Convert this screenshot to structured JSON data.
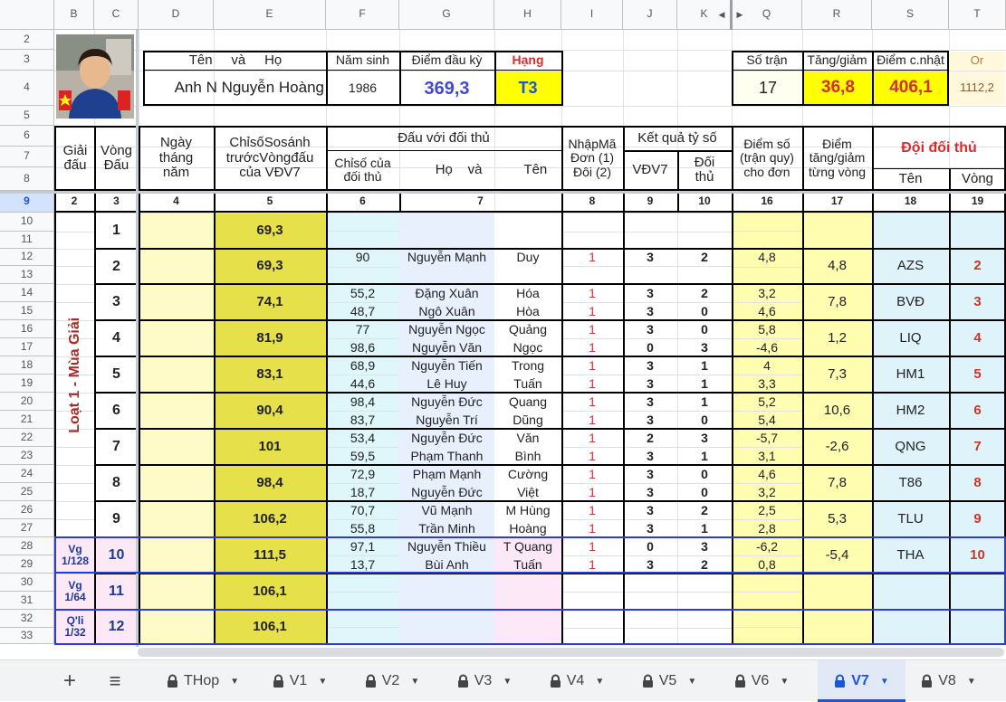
{
  "col_headers": [
    "B",
    "C",
    "D",
    "E",
    "F",
    "G",
    "H",
    "I",
    "J",
    "K",
    "Q",
    "R",
    "S",
    "T"
  ],
  "row_numbers": [
    "2",
    "3",
    "4",
    "5",
    "6",
    "7",
    "8",
    "9",
    "10",
    "11",
    "12",
    "13",
    "14",
    "15",
    "16",
    "17",
    "18",
    "19",
    "20",
    "21",
    "22",
    "23",
    "24",
    "25",
    "26",
    "27",
    "28",
    "29",
    "30",
    "31",
    "32",
    "33"
  ],
  "header": {
    "ten": "Tên",
    "va": "và",
    "ho": "Họ",
    "nam_sinh": "Năm sinh",
    "diem_dau_ky": "Điểm đầu kỳ",
    "hang": "Hạng",
    "name_first": "Anh N",
    "name_last": "Nguyễn Hoàng",
    "year": "1986",
    "diem": "369,3",
    "rank": "T3",
    "so_tran": "Số trận",
    "tang_giam": "Tăng/giảm",
    "diem_cnhat": "Điểm c.nhật",
    "or": "Or",
    "so_tran_v": "17",
    "tang_giam_v": "36,8",
    "diem_cnhat_v": "406,1",
    "or_v": "1112,2"
  },
  "table_header": {
    "giai": "Giải\nđấu",
    "vong": "Vòng\nĐấu",
    "ngay": "Ngày\ntháng\nnăm",
    "chiso": "ChỉsốSosánh\ntrướcVòngđấu\ncủa VĐV7",
    "dau_voi": "Đấu với đối thủ",
    "chiso_dt": "Chỉsố của\nđối thủ",
    "ho": "Họ",
    "va": "và",
    "ten": "Tên",
    "nhapma": "NhậpMã\nĐơn (1)\nĐôi (2)",
    "ketqua": "Kết quả tỷ số",
    "vdv7": "VĐV7",
    "doithu": "Đối\nthủ",
    "diemso": "Điểm số\n(trận quy)\ncho đơn",
    "diem_tg": "Điểm\ntăng/giảm\ntừng vòng",
    "doi_doi_thu": "Đội đối thủ",
    "ten2": "Tên",
    "vong2": "Vòng"
  },
  "col_index": [
    "2",
    "3",
    "4",
    "5",
    "6",
    "7",
    "8",
    "9",
    "10",
    "16",
    "17",
    "18",
    "19"
  ],
  "season_label": "Loạt 1 - Mùa Giải",
  "rounds": [
    {
      "giai": "",
      "vong": "1",
      "chiso": "69,3",
      "tg": "",
      "team": "",
      "tv": "",
      "matches": []
    },
    {
      "giai": "",
      "vong": "2",
      "chiso": "69,3",
      "tg": "4,8",
      "team": "AZS",
      "tv": "2",
      "matches": [
        {
          "cs": "90",
          "ho": "Nguyễn Mạnh",
          "ten": "Duy",
          "m": "1",
          "a": "3",
          "b": "2",
          "d": "4,8"
        }
      ]
    },
    {
      "giai": "",
      "vong": "3",
      "chiso": "74,1",
      "tg": "7,8",
      "team": "BVĐ",
      "tv": "3",
      "matches": [
        {
          "cs": "55,2",
          "ho": "Đặng Xuân",
          "ten": "Hóa",
          "m": "1",
          "a": "3",
          "b": "2",
          "d": "3,2"
        },
        {
          "cs": "48,7",
          "ho": "Ngô Xuân",
          "ten": "Hòa",
          "m": "1",
          "a": "3",
          "b": "0",
          "d": "4,6"
        }
      ]
    },
    {
      "giai": "",
      "vong": "4",
      "chiso": "81,9",
      "tg": "1,2",
      "team": "LIQ",
      "tv": "4",
      "matches": [
        {
          "cs": "77",
          "ho": "Nguyễn Ngọc",
          "ten": "Quảng",
          "m": "1",
          "a": "3",
          "b": "0",
          "d": "5,8"
        },
        {
          "cs": "98,6",
          "ho": "Nguyễn Văn",
          "ten": "Ngọc",
          "m": "1",
          "a": "0",
          "b": "3",
          "d": "-4,6"
        }
      ]
    },
    {
      "giai": "",
      "vong": "5",
      "chiso": "83,1",
      "tg": "7,3",
      "team": "HM1",
      "tv": "5",
      "matches": [
        {
          "cs": "68,9",
          "ho": "Nguyễn Tiến",
          "ten": "Trong",
          "m": "1",
          "a": "3",
          "b": "1",
          "d": "4"
        },
        {
          "cs": "44,6",
          "ho": "Lê Huy",
          "ten": "Tuấn",
          "m": "1",
          "a": "3",
          "b": "1",
          "d": "3,3"
        }
      ]
    },
    {
      "giai": "",
      "vong": "6",
      "chiso": "90,4",
      "tg": "10,6",
      "team": "HM2",
      "tv": "6",
      "matches": [
        {
          "cs": "98,4",
          "ho": "Nguyễn Đức",
          "ten": "Quang",
          "m": "1",
          "a": "3",
          "b": "1",
          "d": "5,2"
        },
        {
          "cs": "83,7",
          "ho": "Nguyễn Trí",
          "ten": "Dũng",
          "m": "1",
          "a": "3",
          "b": "0",
          "d": "5,4"
        }
      ]
    },
    {
      "giai": "",
      "vong": "7",
      "chiso": "101",
      "tg": "-2,6",
      "team": "QNG",
      "tv": "7",
      "matches": [
        {
          "cs": "53,4",
          "ho": "Nguyễn Đức",
          "ten": "Văn",
          "m": "1",
          "a": "2",
          "b": "3",
          "d": "-5,7"
        },
        {
          "cs": "59,5",
          "ho": "Phạm Thanh",
          "ten": "Bình",
          "m": "1",
          "a": "3",
          "b": "1",
          "d": "3,1"
        }
      ]
    },
    {
      "giai": "",
      "vong": "8",
      "chiso": "98,4",
      "tg": "7,8",
      "team": "T86",
      "tv": "8",
      "matches": [
        {
          "cs": "72,9",
          "ho": "Phạm Mạnh",
          "ten": "Cường",
          "m": "1",
          "a": "3",
          "b": "0",
          "d": "4,6"
        },
        {
          "cs": "18,7",
          "ho": "Nguyễn Đức",
          "ten": "Việt",
          "m": "1",
          "a": "3",
          "b": "0",
          "d": "3,2"
        }
      ]
    },
    {
      "giai": "",
      "vong": "9",
      "chiso": "106,2",
      "tg": "5,3",
      "team": "TLU",
      "tv": "9",
      "matches": [
        {
          "cs": "70,7",
          "ho": "Vũ Mạnh",
          "ten": "M Hùng",
          "m": "1",
          "a": "3",
          "b": "2",
          "d": "2,5"
        },
        {
          "cs": "55,8",
          "ho": "Trần Minh",
          "ten": "Hoàng",
          "m": "1",
          "a": "3",
          "b": "1",
          "d": "2,8"
        }
      ]
    },
    {
      "giai": "Vg\n1/128",
      "vong": "10",
      "chiso": "111,5",
      "tg": "-5,4",
      "team": "THA",
      "tv": "10",
      "matches": [
        {
          "cs": "97,1",
          "ho": "Nguyễn Thiều",
          "ten": "T Quang",
          "m": "1",
          "a": "0",
          "b": "3",
          "d": "-6,2"
        },
        {
          "cs": "13,7",
          "ho": "Bùi Anh",
          "ten": "Tuấn",
          "m": "1",
          "a": "3",
          "b": "2",
          "d": "0,8"
        }
      ]
    },
    {
      "giai": "Vg\n1/64",
      "vong": "11",
      "chiso": "106,1",
      "tg": "",
      "team": "",
      "tv": "",
      "matches": []
    },
    {
      "giai": "Q'li\n1/32",
      "vong": "12",
      "chiso": "106,1",
      "tg": "",
      "team": "",
      "tv": "",
      "matches": []
    }
  ],
  "tabs": [
    "THop",
    "V1",
    "V2",
    "V3",
    "V4",
    "V5",
    "V6",
    "V7",
    "V8"
  ],
  "active_tab": "V7",
  "icons": {
    "add": "plus-icon",
    "menu": "menu-icon",
    "lock": "lock-icon",
    "dropdown": "caret-down-icon"
  }
}
